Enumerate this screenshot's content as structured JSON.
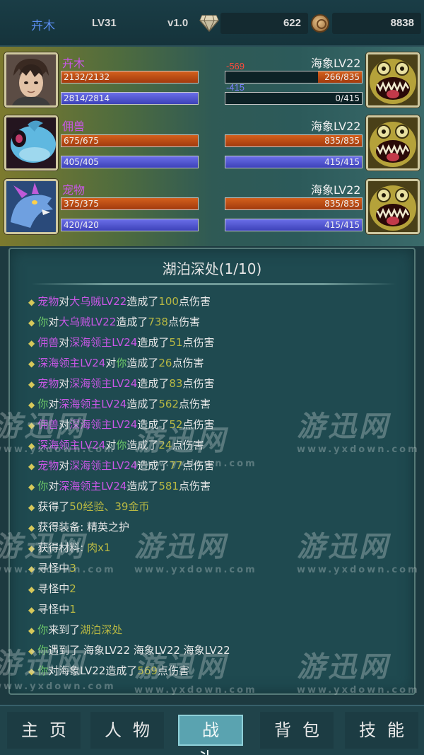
{
  "topbar": {
    "player_name": "卉木",
    "level": "LV31",
    "version": "v1.0",
    "diamonds": "622",
    "coins": "8838"
  },
  "battle": {
    "allies": [
      {
        "name": "卉木",
        "hp": "2132/2132",
        "mp": "2814/2814",
        "hp_ratio": 1.0,
        "mp_ratio": 1.0,
        "portrait": "hero-portrait"
      },
      {
        "name": "佣兽",
        "hp": "675/675",
        "mp": "405/405",
        "hp_ratio": 1.0,
        "mp_ratio": 1.0,
        "portrait": "blue-beast-portrait"
      },
      {
        "name": "宠物",
        "hp": "375/375",
        "mp": "420/420",
        "hp_ratio": 1.0,
        "mp_ratio": 1.0,
        "portrait": "pet-dragon-portrait"
      }
    ],
    "enemies": [
      {
        "name": "海象LV22",
        "hp": "266/835",
        "mp": "0/415",
        "hp_ratio": 0.319,
        "mp_ratio": 0.0,
        "hp_damage": "-569",
        "mp_damage": "-415",
        "portrait": "walrus-monster-portrait"
      },
      {
        "name": "海象LV22",
        "hp": "835/835",
        "mp": "415/415",
        "hp_ratio": 1.0,
        "mp_ratio": 1.0,
        "portrait": "walrus-monster-portrait"
      },
      {
        "name": "海象LV22",
        "hp": "835/835",
        "mp": "415/415",
        "hp_ratio": 1.0,
        "mp_ratio": 1.0,
        "portrait": "walrus-monster-portrait"
      }
    ]
  },
  "log_panel": {
    "title": "湖泊深处(1/10)",
    "lines": [
      [
        {
          "t": "宠物",
          "c": "purple"
        },
        {
          "t": "对",
          "c": "white"
        },
        {
          "t": "大乌贼LV22",
          "c": "purple"
        },
        {
          "t": "造成了",
          "c": "white"
        },
        {
          "t": "100",
          "c": "yellow"
        },
        {
          "t": "点伤害",
          "c": "white"
        }
      ],
      [
        {
          "t": "你",
          "c": "green"
        },
        {
          "t": "对",
          "c": "white"
        },
        {
          "t": "大乌贼LV22",
          "c": "purple"
        },
        {
          "t": "造成了",
          "c": "white"
        },
        {
          "t": "738",
          "c": "yellow"
        },
        {
          "t": "点伤害",
          "c": "white"
        }
      ],
      [
        {
          "t": "佣兽",
          "c": "purple"
        },
        {
          "t": "对",
          "c": "white"
        },
        {
          "t": "深海领主LV24",
          "c": "purple"
        },
        {
          "t": "造成了",
          "c": "white"
        },
        {
          "t": "51",
          "c": "yellow"
        },
        {
          "t": "点伤害",
          "c": "white"
        }
      ],
      [
        {
          "t": "深海领主LV24",
          "c": "purple"
        },
        {
          "t": "对",
          "c": "white"
        },
        {
          "t": "你",
          "c": "green"
        },
        {
          "t": "造成了",
          "c": "white"
        },
        {
          "t": "26",
          "c": "yellow"
        },
        {
          "t": "点伤害",
          "c": "white"
        }
      ],
      [
        {
          "t": "宠物",
          "c": "purple"
        },
        {
          "t": "对",
          "c": "white"
        },
        {
          "t": "深海领主LV24",
          "c": "purple"
        },
        {
          "t": "造成了",
          "c": "white"
        },
        {
          "t": "83",
          "c": "yellow"
        },
        {
          "t": "点伤害",
          "c": "white"
        }
      ],
      [
        {
          "t": "你",
          "c": "green"
        },
        {
          "t": "对",
          "c": "white"
        },
        {
          "t": "深海领主LV24",
          "c": "purple"
        },
        {
          "t": "造成了",
          "c": "white"
        },
        {
          "t": "562",
          "c": "yellow"
        },
        {
          "t": "点伤害",
          "c": "white"
        }
      ],
      [
        {
          "t": "佣兽",
          "c": "purple"
        },
        {
          "t": "对",
          "c": "white"
        },
        {
          "t": "深海领主LV24",
          "c": "purple"
        },
        {
          "t": "造成了",
          "c": "white"
        },
        {
          "t": "52",
          "c": "yellow"
        },
        {
          "t": "点伤害",
          "c": "white"
        }
      ],
      [
        {
          "t": "深海领主LV24",
          "c": "purple"
        },
        {
          "t": "对",
          "c": "white"
        },
        {
          "t": "你",
          "c": "green"
        },
        {
          "t": "造成了",
          "c": "white"
        },
        {
          "t": "24",
          "c": "yellow"
        },
        {
          "t": "点伤害",
          "c": "white"
        }
      ],
      [
        {
          "t": "宠物",
          "c": "purple"
        },
        {
          "t": "对",
          "c": "white"
        },
        {
          "t": "深海领主LV24",
          "c": "purple"
        },
        {
          "t": "造成了",
          "c": "white"
        },
        {
          "t": "77",
          "c": "yellow"
        },
        {
          "t": "点伤害",
          "c": "white"
        }
      ],
      [
        {
          "t": "你",
          "c": "green"
        },
        {
          "t": "对",
          "c": "white"
        },
        {
          "t": "深海领主LV24",
          "c": "purple"
        },
        {
          "t": "造成了",
          "c": "white"
        },
        {
          "t": "581",
          "c": "yellow"
        },
        {
          "t": "点伤害",
          "c": "white"
        }
      ],
      [
        {
          "t": "获得了",
          "c": "white"
        },
        {
          "t": "50经验、39金币",
          "c": "yellow"
        }
      ],
      [
        {
          "t": "获得装备: 精英之护",
          "c": "white"
        }
      ],
      [
        {
          "t": "获得材料: ",
          "c": "white"
        },
        {
          "t": "肉x1",
          "c": "yellow"
        }
      ],
      [
        {
          "t": "寻怪中",
          "c": "white"
        },
        {
          "t": "3",
          "c": "yellow"
        }
      ],
      [
        {
          "t": "寻怪中",
          "c": "white"
        },
        {
          "t": "2",
          "c": "yellow"
        }
      ],
      [
        {
          "t": "寻怪中",
          "c": "white"
        },
        {
          "t": "1",
          "c": "yellow"
        }
      ],
      [
        {
          "t": "你",
          "c": "green"
        },
        {
          "t": "来到了",
          "c": "white"
        },
        {
          "t": "湖泊深处",
          "c": "yellow"
        }
      ],
      [
        {
          "t": "你",
          "c": "green"
        },
        {
          "t": "遇到了 海象LV22 海象LV22 海象LV22",
          "c": "white"
        }
      ],
      [
        {
          "t": "你",
          "c": "green"
        },
        {
          "t": "对",
          "c": "white"
        },
        {
          "t": "海象LV22",
          "c": "white"
        },
        {
          "t": "造成了",
          "c": "white"
        },
        {
          "t": "569",
          "c": "yellow"
        },
        {
          "t": "点伤害",
          "c": "white"
        }
      ]
    ]
  },
  "nav": {
    "items": [
      "主页",
      "人物",
      "战斗",
      "背包",
      "技能"
    ],
    "active_index": 2
  },
  "watermark": {
    "logo": "游迅网",
    "url": "www.yxdown.com"
  },
  "colors": {
    "purple": "#c957e6",
    "green": "#6ec96a",
    "yellow": "#b8b843",
    "hp_fill": "#c0491a",
    "mp_fill": "#5a5ee0",
    "player_name": "#5a8df0",
    "damage_red": "#ff4a3a",
    "damage_blue": "#7a80ff"
  }
}
